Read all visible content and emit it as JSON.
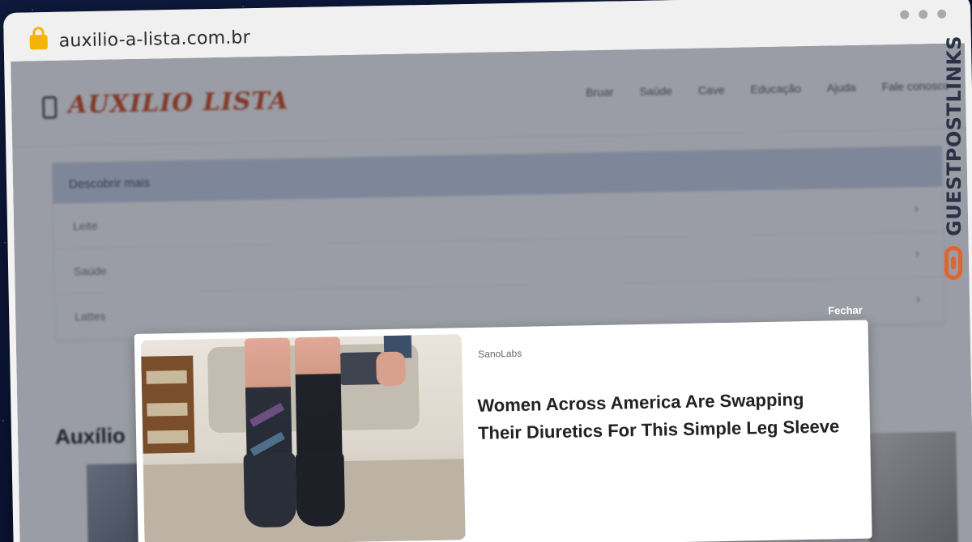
{
  "browser": {
    "url": "auxilio-a-lista.com.br"
  },
  "site": {
    "logo": "AUXILIO LISTA",
    "nav": [
      "Bruar",
      "Saúde",
      "Cave",
      "Educação",
      "Ajuda",
      "Fale conosco"
    ],
    "menu": {
      "header": "Descobrir mais",
      "items": [
        "Leite",
        "Saúde",
        "Lattes"
      ]
    },
    "section_title": "Auxílio"
  },
  "ad": {
    "close_label": "Fechar",
    "source": "SanoLabs",
    "title": "Women Across America Are Swapping Their Diuretics For This Simple Leg Sleeve"
  },
  "watermark": {
    "brand": "GUESTPOSTLINKS"
  },
  "colors": {
    "logo": "#d24a1d",
    "menu_header_bg": "#cdd8ea",
    "brand_accent": "#e4642c",
    "lock": "#f5b400"
  },
  "icons": [
    "lock-icon",
    "window-dots-icon",
    "logo-icon",
    "chevron-right-icon",
    "link-icon"
  ]
}
